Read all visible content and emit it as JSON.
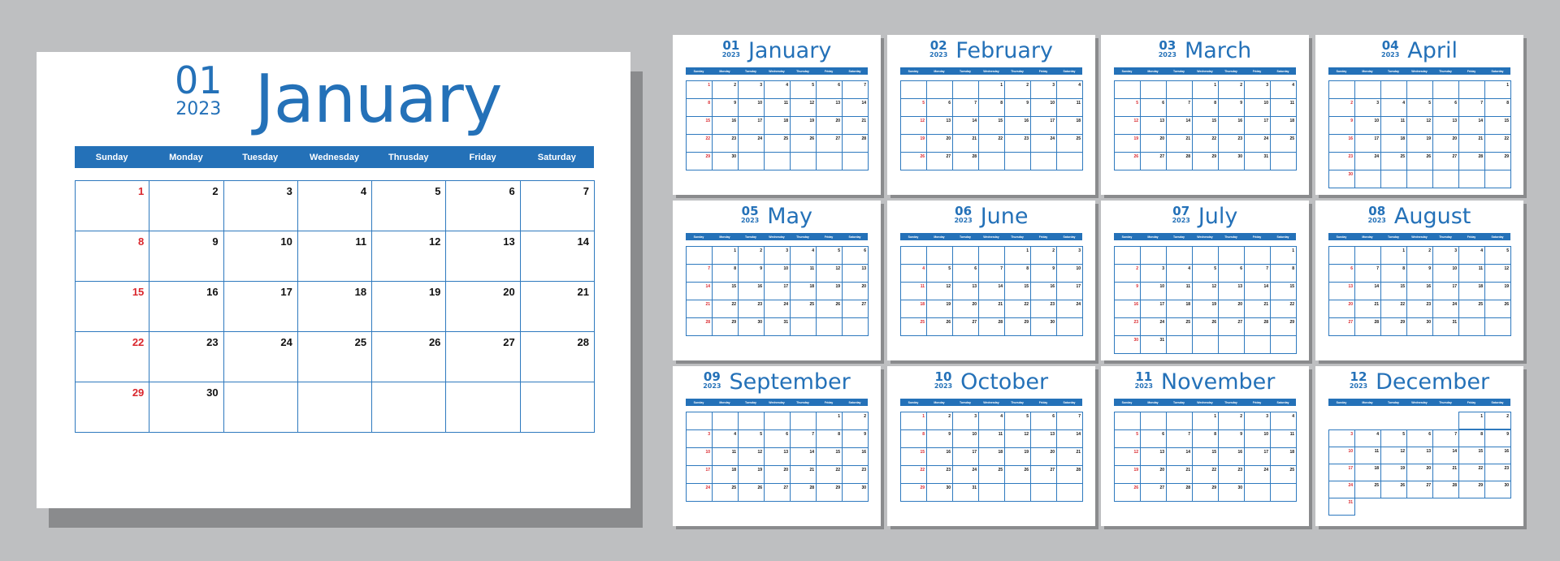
{
  "year": "2023",
  "colors": {
    "accent": "#2471b8",
    "sunday": "#d9262c",
    "background": "#bebfc1",
    "shadow": "#8a8b8d"
  },
  "weekdays_big": [
    "Sunday",
    "Monday",
    "Tuesday",
    "Wednesday",
    "Thrusday",
    "Friday",
    "Saturday"
  ],
  "weekdays_small": [
    "Sunday",
    "Monday",
    "Tuesday",
    "Wednesday",
    "Thursday",
    "Friday",
    "Saturday"
  ],
  "featured": {
    "num": "01",
    "year": "2023",
    "name": "January",
    "start": 0,
    "days": 30
  },
  "months": [
    {
      "num": "01",
      "year": "2023",
      "name": "January",
      "start": 0,
      "days": 30
    },
    {
      "num": "02",
      "year": "2023",
      "name": "February",
      "start": 3,
      "days": 28
    },
    {
      "num": "03",
      "year": "2023",
      "name": "March",
      "start": 3,
      "days": 31
    },
    {
      "num": "04",
      "year": "2023",
      "name": "April",
      "start": 6,
      "days": 30
    },
    {
      "num": "05",
      "year": "2023",
      "name": "May",
      "start": 1,
      "days": 31
    },
    {
      "num": "06",
      "year": "2023",
      "name": "June",
      "start": 4,
      "days": 30
    },
    {
      "num": "07",
      "year": "2023",
      "name": "July",
      "start": 6,
      "days": 31
    },
    {
      "num": "08",
      "year": "2023",
      "name": "August",
      "start": 2,
      "days": 31
    },
    {
      "num": "09",
      "year": "2023",
      "name": "September",
      "start": 5,
      "days": 30
    },
    {
      "num": "10",
      "year": "2023",
      "name": "October",
      "start": 0,
      "days": 31
    },
    {
      "num": "11",
      "year": "2023",
      "name": "November",
      "start": 3,
      "days": 30
    },
    {
      "num": "12",
      "year": "2023",
      "name": "December",
      "start": 5,
      "days": 31,
      "only_day_cells": true
    }
  ]
}
